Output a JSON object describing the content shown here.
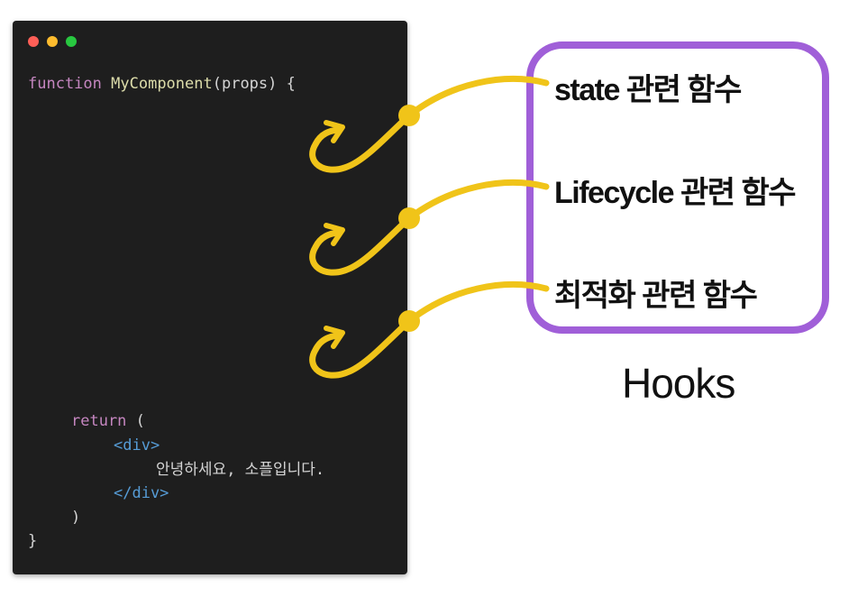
{
  "code": {
    "line1": {
      "kw": "function",
      "fn": "MyComponent",
      "rest": "(props) {"
    },
    "return_line": {
      "kw": "return",
      "rest": " ("
    },
    "open_tag": "<div>",
    "text": "안녕하세요, 소플입니다.",
    "close_tag": "</div>",
    "close_paren": ")",
    "close_brace": "}"
  },
  "hooks": {
    "items": [
      {
        "label": "state 관련 함수"
      },
      {
        "label": "Lifecycle 관련 함수"
      },
      {
        "label": "최적화 관련 함수"
      }
    ],
    "title": "Hooks"
  },
  "colors": {
    "hook_yellow": "#f0c419",
    "box_border": "#a05fd8",
    "editor_bg": "#1e1e1e",
    "keyword": "#c586c0",
    "function_name": "#dcdcaa",
    "tag": "#569cd6"
  }
}
